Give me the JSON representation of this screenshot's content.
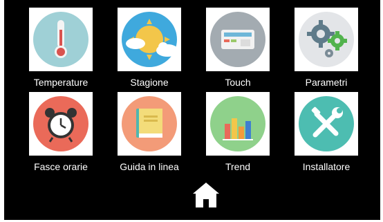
{
  "menu": {
    "items": [
      {
        "label": "Temperature",
        "icon": "thermometer-icon",
        "circle_color": "#9fd0d6"
      },
      {
        "label": "Stagione",
        "icon": "season-sun-cloud-icon",
        "circle_color": "#3fa9dd"
      },
      {
        "label": "Touch",
        "icon": "touch-panel-icon",
        "circle_color": "#a3abb1"
      },
      {
        "label": "Parametri",
        "icon": "gears-icon",
        "circle_color": "#e3e5e8"
      },
      {
        "label": "Fasce orarie",
        "icon": "alarm-clock-icon",
        "circle_color": "#ea6a59"
      },
      {
        "label": "Guida in linea",
        "icon": "book-icon",
        "circle_color": "#f39b78"
      },
      {
        "label": "Trend",
        "icon": "bar-chart-icon",
        "circle_color": "#8fd18b"
      },
      {
        "label": "Installatore",
        "icon": "tools-icon",
        "circle_color": "#4dbdb1"
      }
    ]
  },
  "footer": {
    "home_icon": "home-icon"
  },
  "colors": {
    "background": "#000000",
    "tile": "#ffffff",
    "text": "#ffffff"
  }
}
